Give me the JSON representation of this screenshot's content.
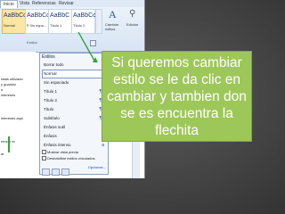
{
  "ribbon": {
    "tabs": [
      "Vista",
      "Referencias",
      "Revisar"
    ],
    "active_tab": "Inicio",
    "styles": [
      {
        "sample": "AaBbCcDc",
        "name": "Normal"
      },
      {
        "sample": "AaBbCcDc",
        "name": "¶ Sin espa..."
      },
      {
        "sample": "AaBbC",
        "name": "Título 1"
      },
      {
        "sample": "AaBbCc",
        "name": "Título 2"
      }
    ],
    "change_styles_label": "Cambiar estilos",
    "editing_label": "Edición",
    "group_label": "Estilos",
    "change_styles_glyph": "A"
  },
  "doc_lines": [
    "ratas utilizado",
    "y guardar",
    "s",
    "intereses",
    "intereses aquí",
    "rencer el",
    "ar"
  ],
  "styles_pane": {
    "title": "Estilos",
    "items": [
      {
        "label": "Borrar todo",
        "mark": ""
      },
      {
        "label": "Normal",
        "mark": "¶"
      },
      {
        "label": "Sin espaciado",
        "mark": "¶"
      },
      {
        "label": "Título 1",
        "mark": "¶a"
      },
      {
        "label": "Título 2",
        "mark": "¶a"
      },
      {
        "label": "Título",
        "mark": "¶a"
      },
      {
        "label": "Subtítulo",
        "mark": "¶a"
      },
      {
        "label": "Énfasis sutil",
        "mark": "a"
      },
      {
        "label": "Énfasis",
        "mark": "a"
      },
      {
        "label": "Énfasis intenso",
        "mark": "a"
      }
    ],
    "options": [
      "Mostrar vista previa",
      "Deshabilitar estilos vinculados"
    ],
    "link_label": "Opciones..."
  },
  "callout": {
    "text": "Si queremos cambiar estilo se le da clic en cambiar  y tambien don se es encuentra la flechita"
  },
  "colors": {
    "callout_bg": "#9ec75a",
    "arrow": "#2fa83a",
    "slide_bg": "#474747"
  }
}
